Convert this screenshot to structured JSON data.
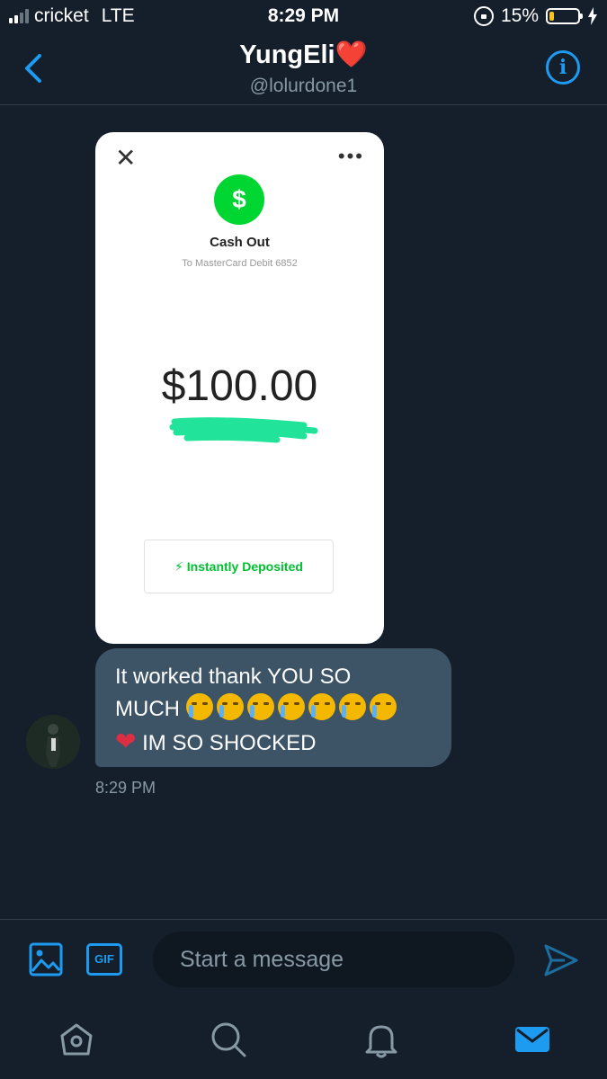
{
  "status": {
    "carrier": "cricket",
    "network": "LTE",
    "time": "8:29 PM",
    "battery_percent": "15%",
    "battery_level": 0.15,
    "signal_bars": 2
  },
  "header": {
    "title": "YungEli",
    "title_emoji": "❤️",
    "handle": "@lolurdone1",
    "info_glyph": "i"
  },
  "card": {
    "close_glyph": "✕",
    "more_glyph": "•••",
    "icon_glyph": "$",
    "title": "Cash Out",
    "subtitle": "To MasterCard Debit 6852",
    "amount": "$100.00",
    "deposit_label": "⚡ Instantly Deposited",
    "brand_color": "#00d632"
  },
  "message": {
    "line1": "It worked thank YOU SO",
    "line2_text": "MUCH ",
    "line3_text": " IM SO SHOCKED",
    "heart": "❤",
    "crying_emoji_count": 7,
    "time": "8:29 PM"
  },
  "composer": {
    "gif_label": "GIF",
    "placeholder": "Start a message"
  },
  "colors": {
    "background": "#151f2b",
    "accent": "#1d9bf0",
    "bubble": "#3d5466"
  },
  "nav": {
    "icons": [
      "home-icon",
      "search-icon",
      "notifications-icon",
      "messages-icon"
    ]
  }
}
